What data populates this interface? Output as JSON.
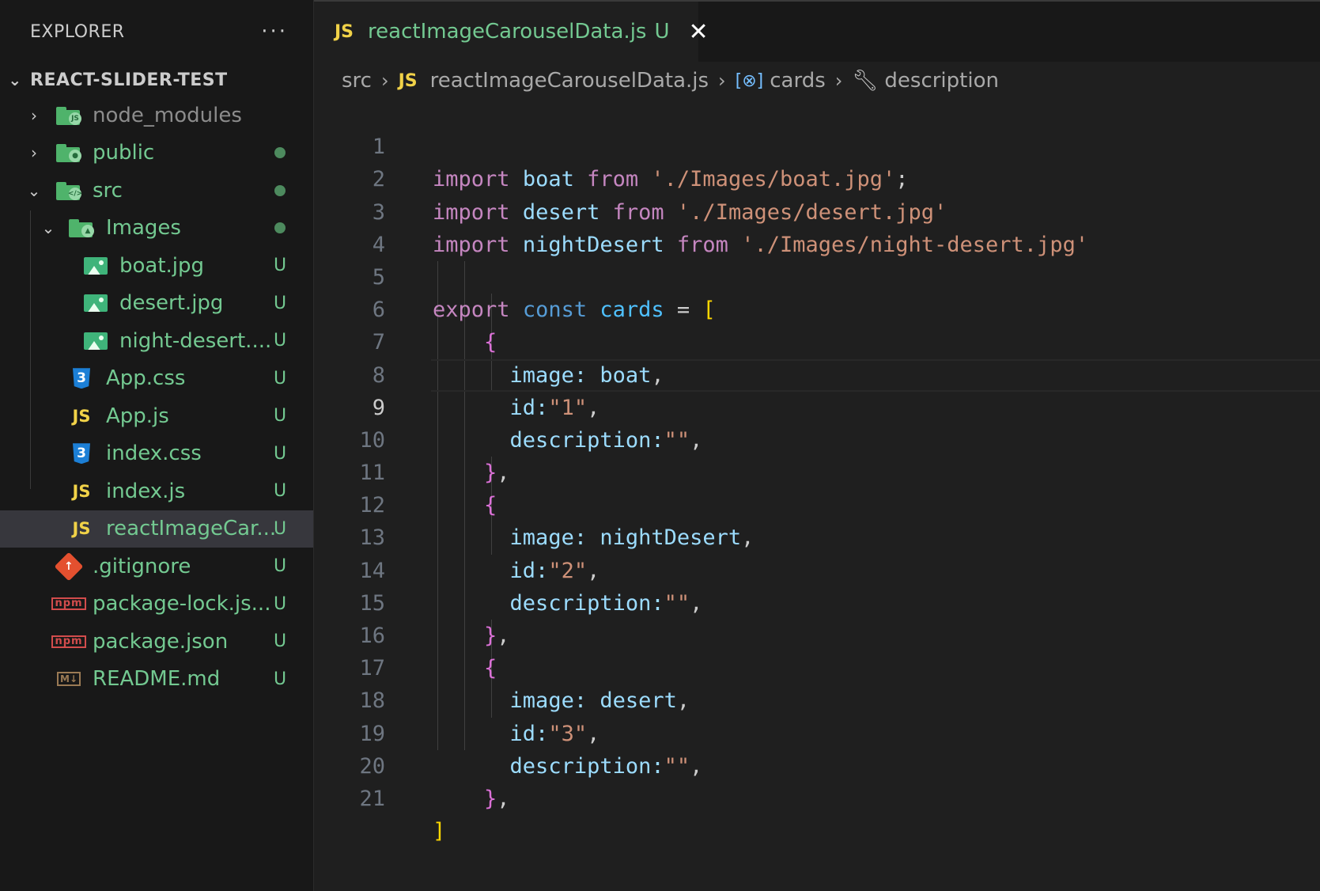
{
  "sidebar": {
    "title": "EXPLORER",
    "more_actions": "···",
    "root_label": "REACT-SLIDER-TEST",
    "items": [
      {
        "label": "node_modules",
        "badge": ""
      },
      {
        "label": "public",
        "badge": ""
      },
      {
        "label": "src",
        "badge": ""
      },
      {
        "label": "Images",
        "badge": ""
      },
      {
        "label": "boat.jpg",
        "badge": "U"
      },
      {
        "label": "desert.jpg",
        "badge": "U"
      },
      {
        "label": "night-desert....",
        "badge": "U"
      },
      {
        "label": "App.css",
        "badge": "U"
      },
      {
        "label": "App.js",
        "badge": "U"
      },
      {
        "label": "index.css",
        "badge": "U"
      },
      {
        "label": "index.js",
        "badge": "U"
      },
      {
        "label": "reactImageCar...",
        "badge": "U"
      },
      {
        "label": ".gitignore",
        "badge": "U"
      },
      {
        "label": "package-lock.js...",
        "badge": "U"
      },
      {
        "label": "package.json",
        "badge": "U"
      },
      {
        "label": "README.md",
        "badge": "U"
      }
    ]
  },
  "tab": {
    "icon_text": "JS",
    "filename": "reactImageCarouselData.js",
    "status": "U",
    "close_glyph": "✕"
  },
  "breadcrumb": {
    "folder": "src",
    "file": "reactImageCarouselData.js",
    "symbol1": "cards",
    "symbol2": "description"
  },
  "editor": {
    "current_line": 9,
    "line_numbers": [
      "1",
      "2",
      "3",
      "4",
      "5",
      "6",
      "7",
      "8",
      "9",
      "10",
      "11",
      "12",
      "13",
      "14",
      "15",
      "16",
      "17",
      "18",
      "19",
      "20",
      "21"
    ],
    "code": {
      "l1": {
        "kw": "import",
        "name": "boat",
        "from": "from",
        "path": "'./Images/boat.jpg'",
        "end": ";"
      },
      "l2": {
        "kw": "import",
        "name": "desert",
        "from": "from",
        "path": "'./Images/desert.jpg'"
      },
      "l3": {
        "kw": "import",
        "name": "nightDesert",
        "from": "from",
        "path": "'./Images/night-desert.jpg'"
      },
      "l5": {
        "kw": "export",
        "kw2": "const",
        "name": "cards",
        "eq": "=",
        "open": "["
      },
      "cards": [
        {
          "image_key": "image:",
          "image_val": "boat",
          "id_key": "id:",
          "id_val": "\"1\"",
          "desc_key": "description:",
          "desc_val": "\"\""
        },
        {
          "image_key": "image:",
          "image_val": "nightDesert",
          "id_key": "id:",
          "id_val": "\"2\"",
          "desc_key": "description:",
          "desc_val": "\"\""
        },
        {
          "image_key": "image:",
          "image_val": "desert",
          "id_key": "id:",
          "id_val": "\"3\"",
          "desc_key": "description:",
          "desc_val": "\"\""
        }
      ],
      "obj_open": "{",
      "obj_close": "}",
      "comma": ",",
      "close": "]"
    }
  }
}
